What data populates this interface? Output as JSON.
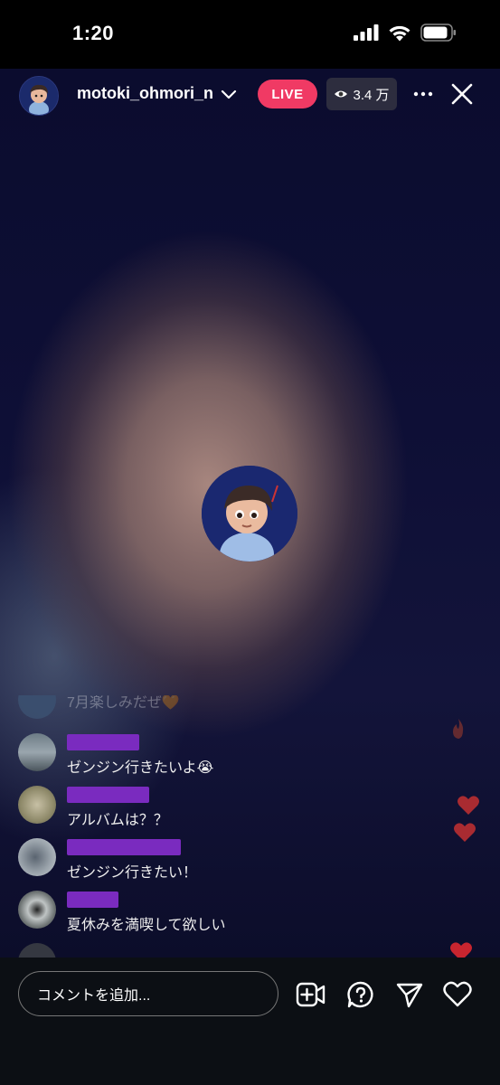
{
  "status_bar": {
    "time": "1:20"
  },
  "header": {
    "username": "motoki_ohmori_n",
    "live_label": "LIVE",
    "viewer_count": "3.4 万"
  },
  "comments": [
    {
      "text": "7月楽しみだぜ🧡",
      "faded": true
    },
    {
      "text": "ゼンジン行きたいよ😭"
    },
    {
      "text": "アルバムは？？"
    },
    {
      "text": "ゼンジン行きたい！"
    },
    {
      "text": "夏休みを満喫して欲しい"
    }
  ],
  "input": {
    "placeholder": "コメントを追加..."
  },
  "colors": {
    "live": "#f03a64",
    "name_redaction": "#7a2bbf",
    "heart": "#c8252f"
  },
  "icons": [
    "signal-icon",
    "wifi-icon",
    "battery-icon",
    "chevron-down-icon",
    "eye-icon",
    "more-icon",
    "close-icon",
    "video-add-icon",
    "question-icon",
    "send-icon",
    "heart-icon"
  ]
}
